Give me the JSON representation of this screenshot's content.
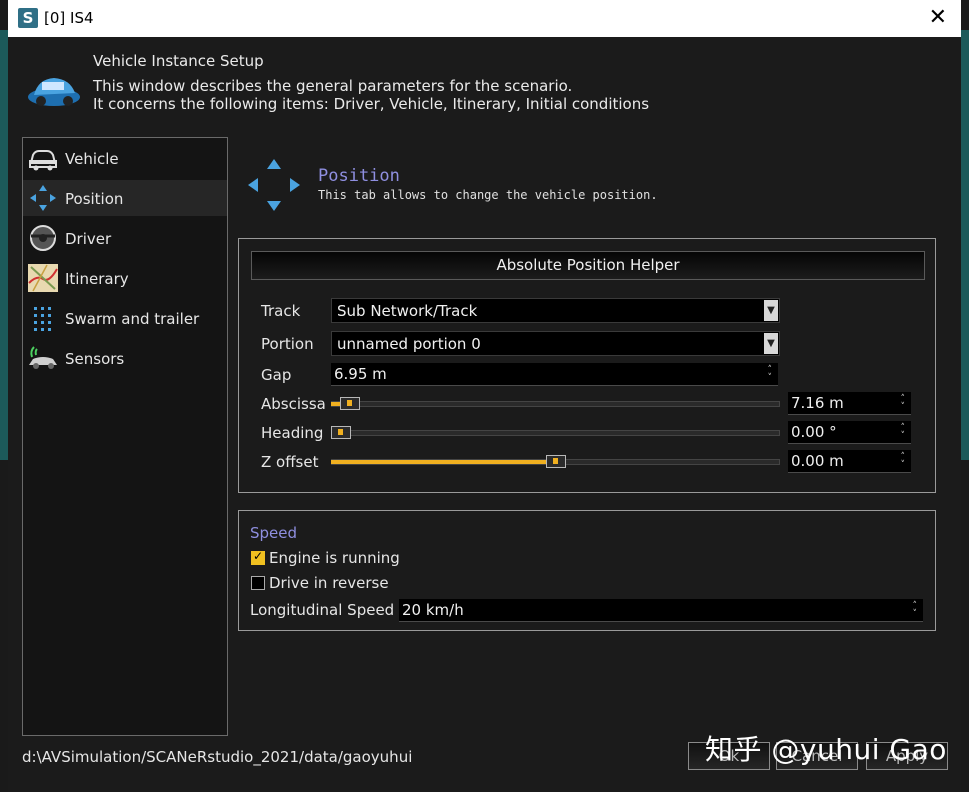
{
  "window": {
    "title": "[0] IS4",
    "app_icon": "S"
  },
  "header": {
    "title": "Vehicle Instance Setup",
    "line1": "This window describes the general parameters for the scenario.",
    "line2": "It concerns the following items: Driver, Vehicle, Itinerary, Initial conditions"
  },
  "sidebar": {
    "items": [
      {
        "label": "Vehicle",
        "icon": "vehicle-icon"
      },
      {
        "label": "Position",
        "icon": "position-arrows-icon"
      },
      {
        "label": "Driver",
        "icon": "steering-wheel-icon"
      },
      {
        "label": "Itinerary",
        "icon": "map-icon"
      },
      {
        "label": "Swarm and trailer",
        "icon": "swarm-dots-icon"
      },
      {
        "label": "Sensors",
        "icon": "sensor-car-icon"
      }
    ],
    "active": "Position"
  },
  "position": {
    "title": "Position",
    "description": "This tab allows to change the vehicle position.",
    "helper_label": "Absolute Position Helper",
    "track_label": "Track",
    "track_value": "Sub Network/Track",
    "portion_label": "Portion",
    "portion_value": "unnamed portion 0",
    "gap_label": "Gap",
    "gap_value": "6.95 m",
    "abscissa_label": "Abscissa",
    "abscissa_value": "7.16 m",
    "abscissa_slider": 0.02,
    "heading_label": "Heading",
    "heading_value": "0.00 °",
    "heading_slider": 0.0,
    "zoffset_label": "Z offset",
    "zoffset_value": "0.00 m",
    "zoffset_slider": 0.5
  },
  "speed": {
    "title": "Speed",
    "engine_label": "Engine is running",
    "engine_checked": true,
    "reverse_label": "Drive in reverse",
    "reverse_checked": false,
    "longitudinal_label": "Longitudinal Speed",
    "longitudinal_value": "20 km/h"
  },
  "footer": {
    "path": "d:\\AVSimulation/SCANeRstudio_2021/data/gaoyuhui",
    "ok": "Ok",
    "cancel": "Cancel",
    "apply": "Apply"
  },
  "watermark": "知乎 @yuhui Gao",
  "colors": {
    "accent": "#f0b020",
    "section_title": "#8f8fe0",
    "background": "#1b1b1b"
  }
}
